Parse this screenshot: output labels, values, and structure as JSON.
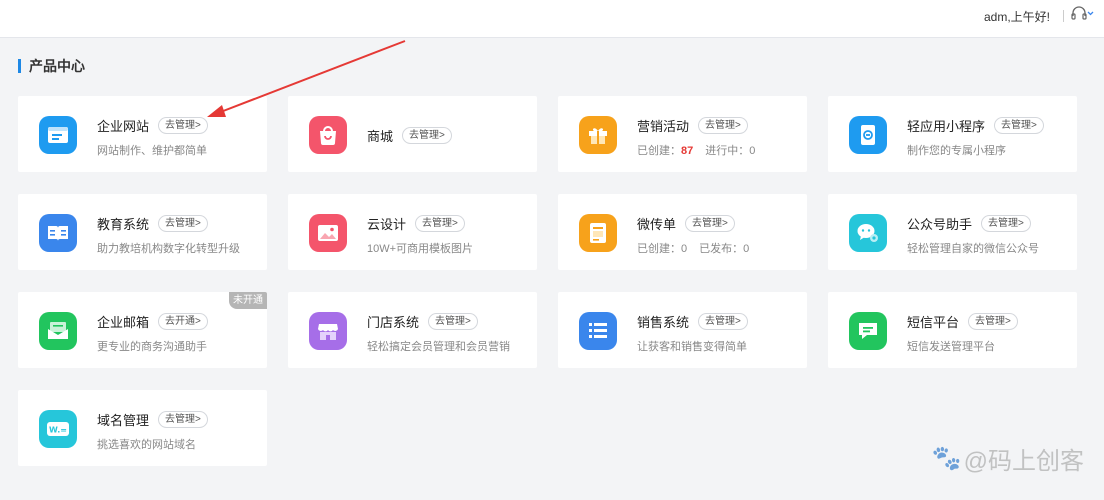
{
  "header": {
    "greeting": "adm,上午好!",
    "support_icon": "headset-icon"
  },
  "section": {
    "title": "产品中心"
  },
  "products": [
    {
      "name": "企业网站",
      "action": "去管理>",
      "desc": "网站制作、维护都简单",
      "icon": "website-icon",
      "color": "#1e9bf0"
    },
    {
      "name": "商城",
      "action": "去管理>",
      "desc": "",
      "icon": "shopping-bag-icon",
      "color": "#f4556b"
    },
    {
      "name": "营销活动",
      "action": "去管理>",
      "desc_prefix": "已创建：",
      "desc_num": "87",
      "desc_suffix": "进行中：0",
      "icon": "gift-icon",
      "color": "#f7a21b"
    },
    {
      "name": "轻应用小程序",
      "action": "去管理>",
      "desc": "制作您的专属小程序",
      "icon": "mini-program-icon",
      "color": "#1e9bf0"
    },
    {
      "name": "教育系统",
      "action": "去管理>",
      "desc": "助力教培机构数字化转型升级",
      "icon": "book-icon",
      "color": "#3a86ec"
    },
    {
      "name": "云设计",
      "action": "去管理>",
      "desc": "10W+可商用模板图片",
      "icon": "image-icon",
      "color": "#f4556b"
    },
    {
      "name": "微传单",
      "action": "去管理>",
      "desc_a": "已创建：0",
      "desc_b": "已发布：0",
      "icon": "flyer-icon",
      "color": "#f7a21b"
    },
    {
      "name": "公众号助手",
      "action": "去管理>",
      "desc": "轻松管理自家的微信公众号",
      "icon": "wechat-icon",
      "color": "#26c6da"
    },
    {
      "name": "企业邮箱",
      "action": "去开通>",
      "desc": "更专业的商务沟通助手",
      "icon": "mail-icon",
      "color": "#22c55e",
      "badge": "未开通"
    },
    {
      "name": "门店系统",
      "action": "去管理>",
      "desc": "轻松搞定会员管理和会员营销",
      "icon": "store-icon",
      "color": "#a66ee8"
    },
    {
      "name": "销售系统",
      "action": "去管理>",
      "desc": "让获客和销售变得简单",
      "icon": "list-icon",
      "color": "#3a86ec"
    },
    {
      "name": "短信平台",
      "action": "去管理>",
      "desc": "短信发送管理平台",
      "icon": "sms-icon",
      "color": "#22c55e"
    },
    {
      "name": "域名管理",
      "action": "去管理>",
      "desc": "挑选喜欢的网站域名",
      "icon": "domain-icon",
      "color": "#26c6da"
    }
  ],
  "watermark": "@码上创客"
}
